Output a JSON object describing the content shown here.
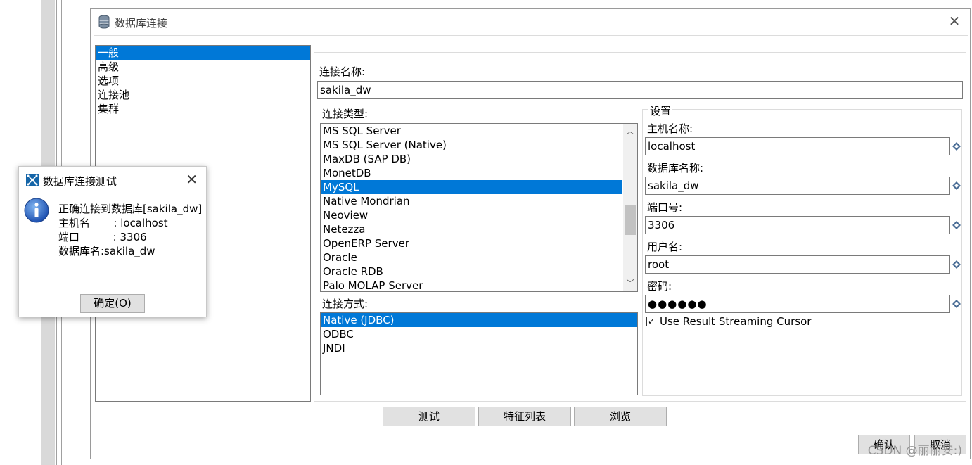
{
  "dialog": {
    "title": "数据库连接"
  },
  "nav": {
    "items": [
      {
        "label": "一般",
        "selected": true
      },
      {
        "label": "高级",
        "selected": false
      },
      {
        "label": "选项",
        "selected": false
      },
      {
        "label": "连接池",
        "selected": false
      },
      {
        "label": "集群",
        "selected": false
      }
    ]
  },
  "form": {
    "connection_name_label": "连接名称:",
    "connection_name_value": "sakila_dw",
    "connection_type_label": "连接类型:",
    "connection_types": [
      {
        "label": "MS SQL Server",
        "selected": false
      },
      {
        "label": "MS SQL Server (Native)",
        "selected": false
      },
      {
        "label": "MaxDB (SAP DB)",
        "selected": false
      },
      {
        "label": "MonetDB",
        "selected": false
      },
      {
        "label": "MySQL",
        "selected": true
      },
      {
        "label": "Native Mondrian",
        "selected": false
      },
      {
        "label": "Neoview",
        "selected": false
      },
      {
        "label": "Netezza",
        "selected": false
      },
      {
        "label": "OpenERP Server",
        "selected": false
      },
      {
        "label": "Oracle",
        "selected": false
      },
      {
        "label": "Oracle RDB",
        "selected": false
      },
      {
        "label": "Palo MOLAP Server",
        "selected": false
      }
    ],
    "access_label": "连接方式:",
    "access_methods": [
      {
        "label": "Native (JDBC)",
        "selected": true
      },
      {
        "label": "ODBC",
        "selected": false
      },
      {
        "label": "JNDI",
        "selected": false
      }
    ]
  },
  "settings": {
    "group_title": "设置",
    "host_label": "主机名称:",
    "host_value": "localhost",
    "db_label": "数据库名称:",
    "db_value": "sakila_dw",
    "port_label": "端口号:",
    "port_value": "3306",
    "user_label": "用户名:",
    "user_value": "root",
    "password_label": "密码:",
    "password_value": "●●●●●●",
    "streaming_label": "Use Result Streaming Cursor",
    "streaming_checked": true
  },
  "buttons": {
    "test": "测试",
    "features": "特征列表",
    "explore": "浏览",
    "ok": "确认",
    "cancel": "取消"
  },
  "msgbox": {
    "title": "数据库连接测试",
    "line1": "正确连接到数据库[sakila_dw]",
    "line2": "主机名       : localhost",
    "line3": "端口          : 3306",
    "line4": "数据库名:sakila_dw",
    "ok_label": "确定(O)"
  },
  "watermark": "CSDN @丽丽安:)",
  "colors": {
    "selection": "#0078d7",
    "button_face": "#e1e1e1"
  }
}
